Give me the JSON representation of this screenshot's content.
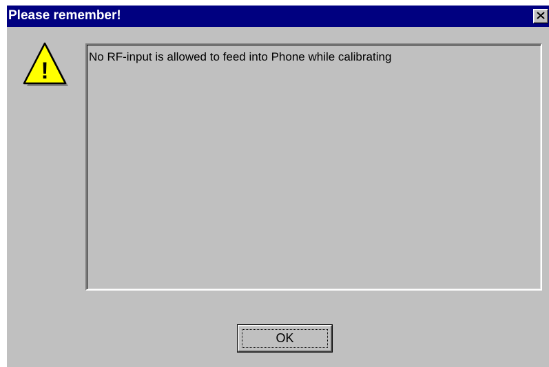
{
  "window": {
    "title": "Please remember!",
    "close_icon": "close-icon",
    "close_glyph": "×"
  },
  "icon": {
    "name": "warning-icon",
    "glyph": "!",
    "fill": "#ffff00",
    "outline": "#000000"
  },
  "message": {
    "text": "No RF-input is allowed to feed into Phone while calibrating"
  },
  "buttons": {
    "ok_label": "OK"
  },
  "colors": {
    "titlebar": "#000080",
    "face": "#c0c0c0",
    "title_text": "#ffffff"
  }
}
